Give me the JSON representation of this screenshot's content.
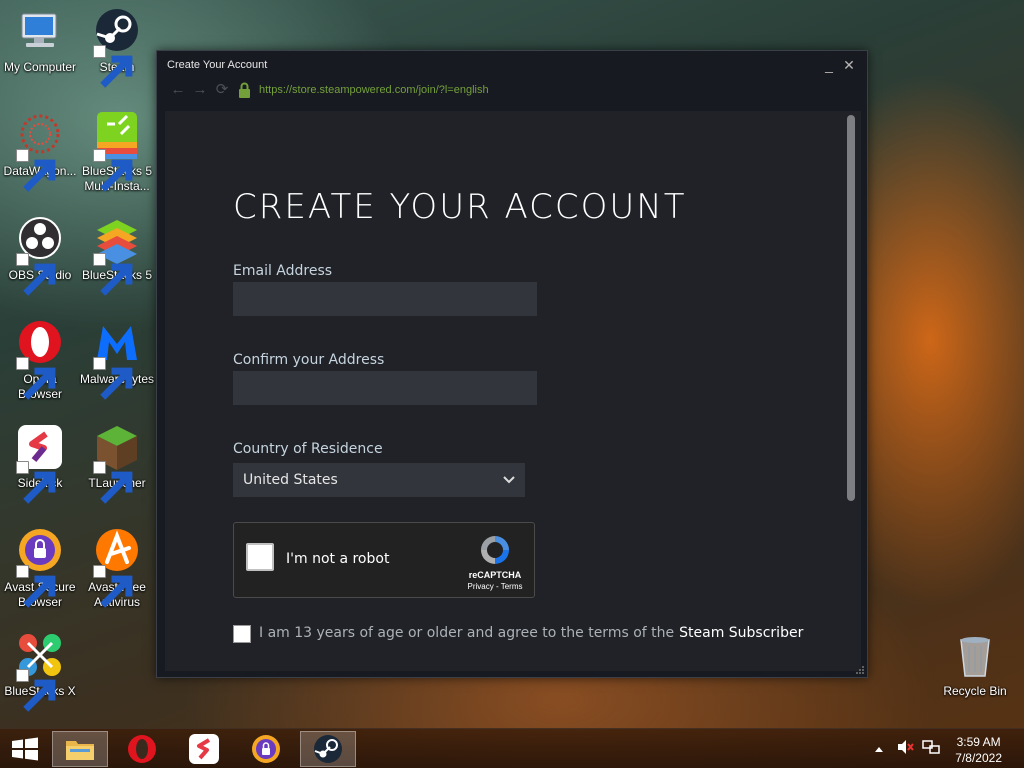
{
  "desktop": {
    "icons": [
      {
        "label": "My Computer"
      },
      {
        "label": "Steam"
      },
      {
        "label": "DataWagon..."
      },
      {
        "label": "BlueStacks 5 Multi-Insta..."
      },
      {
        "label": "OBS Studio"
      },
      {
        "label": "BlueStacks 5"
      },
      {
        "label": "Opera Browser"
      },
      {
        "label": "Malwarebytes"
      },
      {
        "label": "Sidekick"
      },
      {
        "label": "TLauncher"
      },
      {
        "label": "Avast Secure Browser"
      },
      {
        "label": "Avast Free Antivirus"
      },
      {
        "label": "BlueStacks X"
      },
      {
        "label": "Recycle Bin"
      }
    ]
  },
  "window": {
    "title": "Create Your Account",
    "minimize_glyph": "_",
    "close_glyph": "✕",
    "url": "https://store.steampowered.com/join/?l=english",
    "nav": {
      "back": "←",
      "forward": "→",
      "reload": "⟳"
    }
  },
  "form": {
    "heading": "CREATE YOUR ACCOUNT",
    "email_label": "Email Address",
    "email_value": "",
    "confirm_label": "Confirm your Address",
    "confirm_value": "",
    "country_label": "Country of Residence",
    "country_value": "United States",
    "captcha_text": "I'm not a robot",
    "captcha_brand": "reCAPTCHA",
    "captcha_terms": "Privacy - Terms",
    "agree_text": "I am 13 years of age or older and agree to the terms of the",
    "agree_link": "Steam Subscriber"
  },
  "taskbar": {
    "time": "3:59 AM",
    "date": "7/8/2022",
    "items": [
      "File Explorer",
      "Opera",
      "Sidekick",
      "Avast Secure Browser",
      "Steam"
    ]
  },
  "colors": {
    "url_green": "#74a03b",
    "steam_bg": "#171a21",
    "content_bg": "#202227",
    "input_bg": "#32353c"
  }
}
